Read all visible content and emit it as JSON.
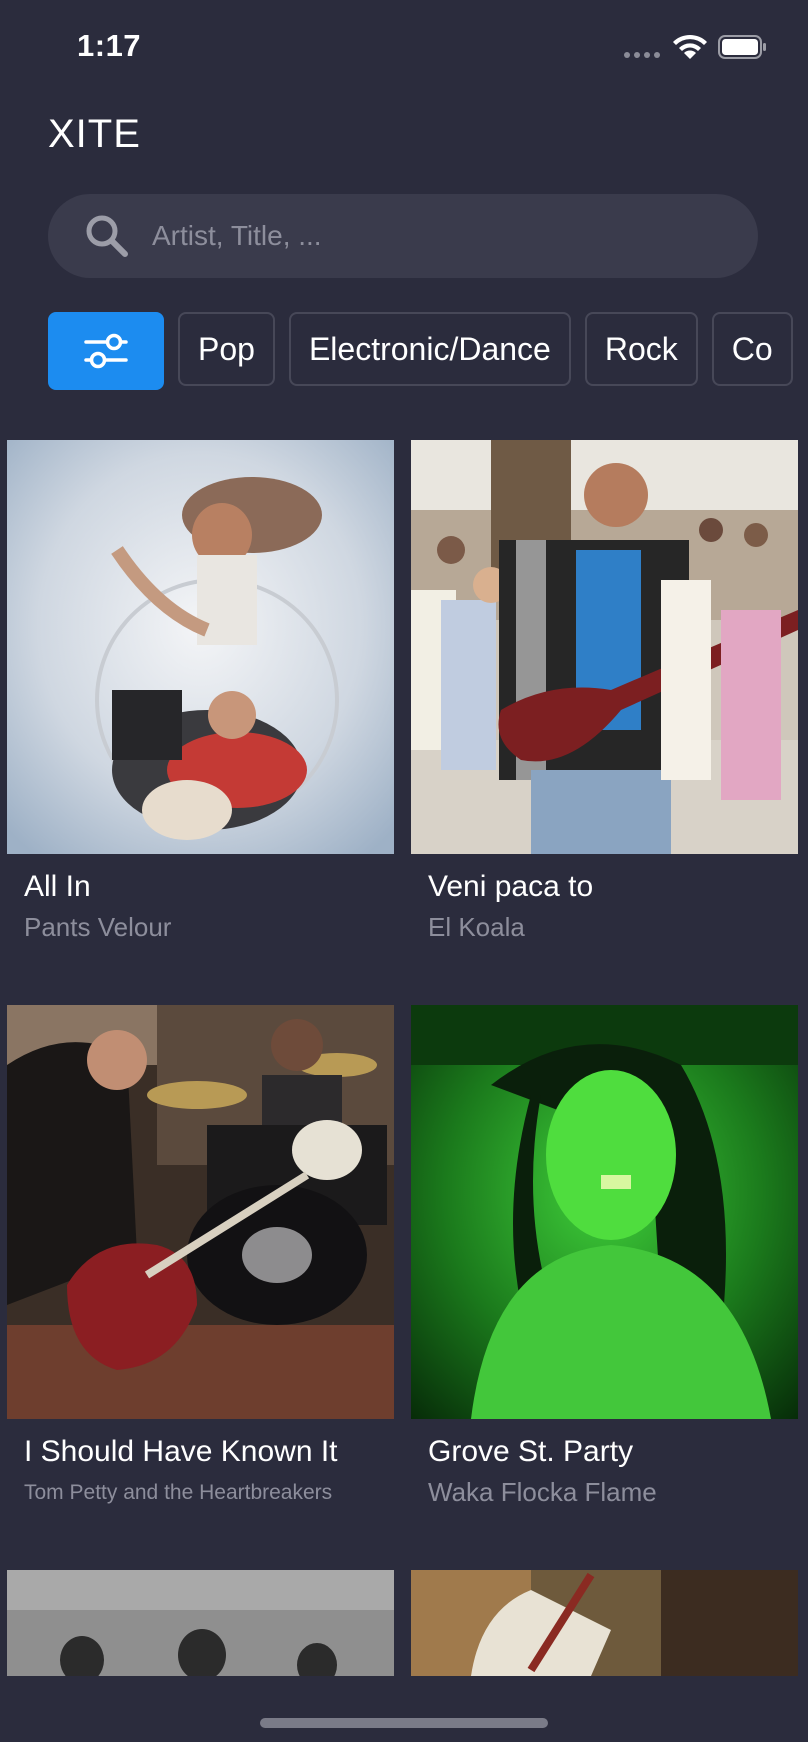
{
  "status": {
    "time": "1:17"
  },
  "app": {
    "title": "XITE"
  },
  "search": {
    "placeholder": "Artist, Title, ..."
  },
  "filters": {
    "chips": [
      "Pop",
      "Electronic/Dance",
      "Rock",
      "Co"
    ]
  },
  "videos": [
    {
      "title": "All In",
      "artist": "Pants Velour"
    },
    {
      "title": "Veni paca to",
      "artist": "El Koala"
    },
    {
      "title": "I Should Have Known It",
      "artist": "Tom Petty and the Heartbreakers"
    },
    {
      "title": "Grove St. Party",
      "artist": "Waka Flocka Flame"
    }
  ],
  "colors": {
    "background": "#2b2c3d",
    "accent": "#1c8cf0",
    "search_bg": "#3a3b4c",
    "muted_text": "#8d8e9c"
  }
}
